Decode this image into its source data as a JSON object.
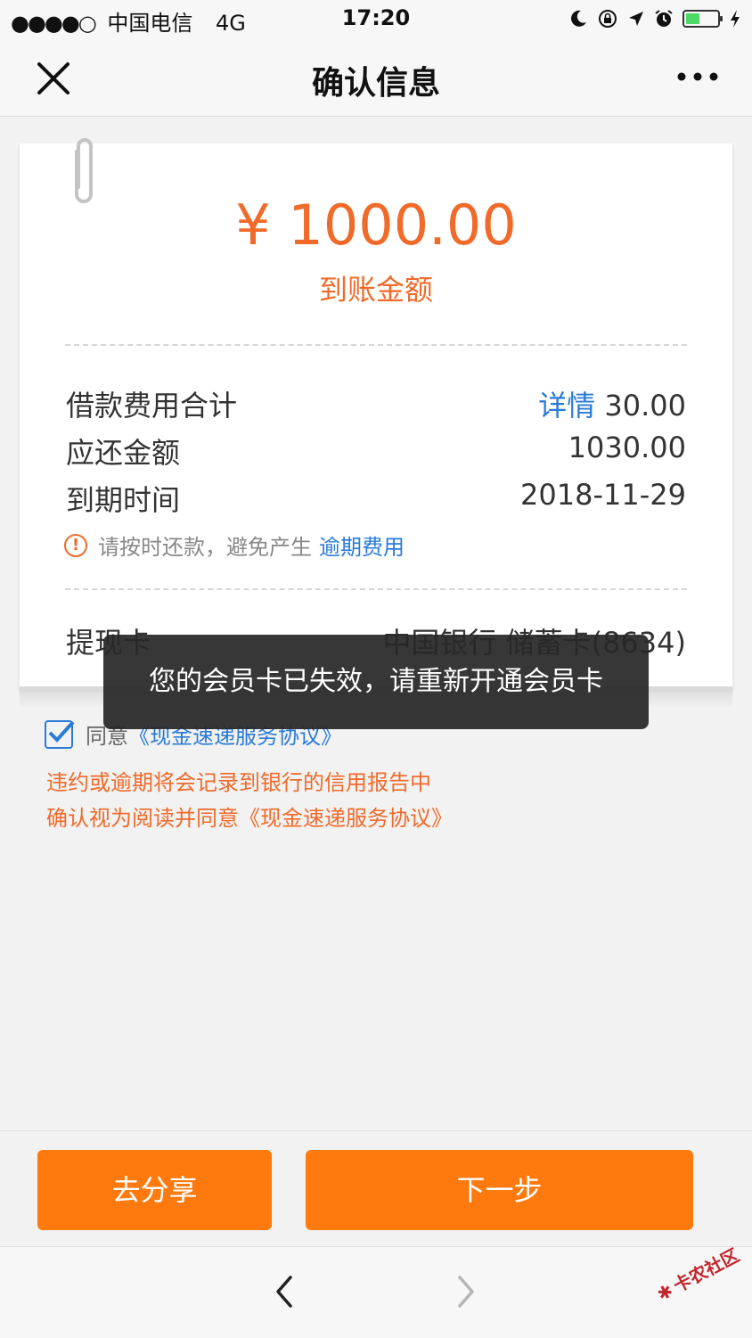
{
  "status_bar": {
    "signal_dots": "●●●●○",
    "carrier": "中国电信",
    "network": "4G",
    "time": "17:20",
    "battery_level": 0.45,
    "icons": [
      "moon-icon",
      "rotation-lock-icon",
      "location-icon",
      "alarm-icon",
      "battery-icon",
      "charging-icon"
    ]
  },
  "nav": {
    "title": "确认信息",
    "close_icon": "close-icon",
    "more_icon": "more-icon"
  },
  "card": {
    "amount": "¥ 1000.00",
    "amount_label": "到账金额",
    "rows": [
      {
        "label": "借款费用合计",
        "link": "详情",
        "value": "30.00"
      },
      {
        "label": "应还金额",
        "value": "1030.00"
      },
      {
        "label": "到期时间",
        "value": "2018-11-29"
      }
    ],
    "warning_text": "请按时还款，避免产生",
    "warning_link": "逾期费用",
    "card_row": {
      "label": "提现卡",
      "value": "中国银行 储蓄卡(8634)"
    }
  },
  "toast": {
    "message": "您的会员卡已失效，请重新开通会员卡"
  },
  "agreement": {
    "checked": true,
    "label": "同意",
    "link": "《现金速递服务协议》",
    "notice_lines": [
      "违约或逾期将会记录到银行的信用报告中",
      "确认视为阅读并同意《现金速递服务协议》"
    ]
  },
  "actions": {
    "share_label": "去分享",
    "next_label": "下一步"
  },
  "toolbar": {
    "back_icon": "back-arrow-icon",
    "forward_icon": "forward-arrow-icon"
  },
  "watermark": {
    "text": "卡农社区"
  },
  "colors": {
    "accent_orange": "#ff7a0e",
    "amount_orange": "#f06a2a",
    "link_blue": "#2a7bd7",
    "toast_bg": "#282828"
  }
}
